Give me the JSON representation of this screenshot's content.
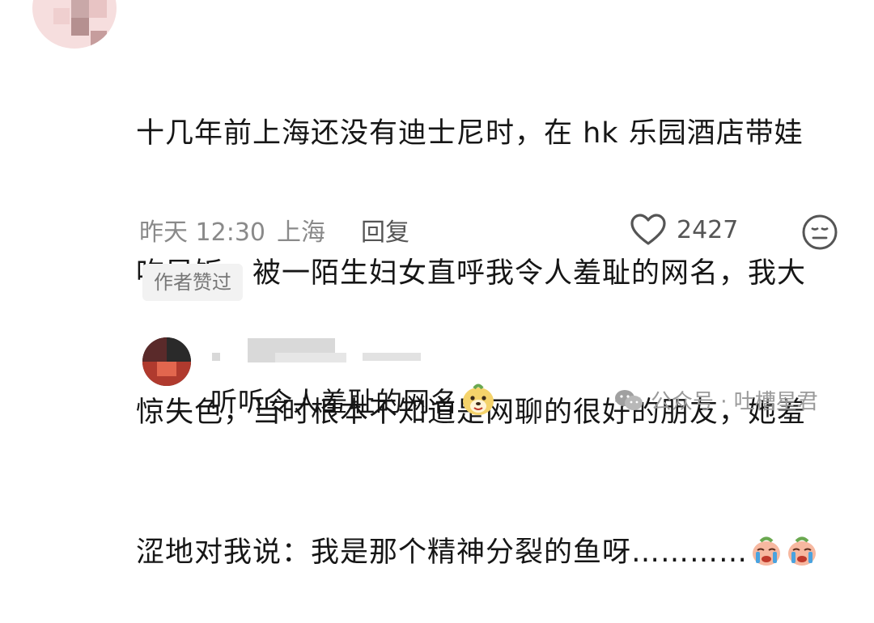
{
  "comment": {
    "text_line1": "十几年前上海还没有迪士尼时，在 hk 乐园酒店带娃",
    "text_line2": "吃早饭，被一陌生妇女直呼我令人羞耻的网名，我大",
    "text_line3": "惊失色，当时根本不知道是网聊的很好的朋友，她羞",
    "text_line4": "涩地对我说：我是那个精神分裂的鱼呀…………",
    "time": "昨天 12:30",
    "location": "上海",
    "reply_label": "回复",
    "like_count": "2427",
    "author_liked_badge": "作者赞过"
  },
  "reply": {
    "text": "听听令人羞耻的网名"
  },
  "watermark": {
    "text": "公众号 · 吐槽星君"
  },
  "colors": {
    "text": "#161616",
    "meta": "#8a8a8a",
    "badge_bg": "#f2f2f2"
  }
}
